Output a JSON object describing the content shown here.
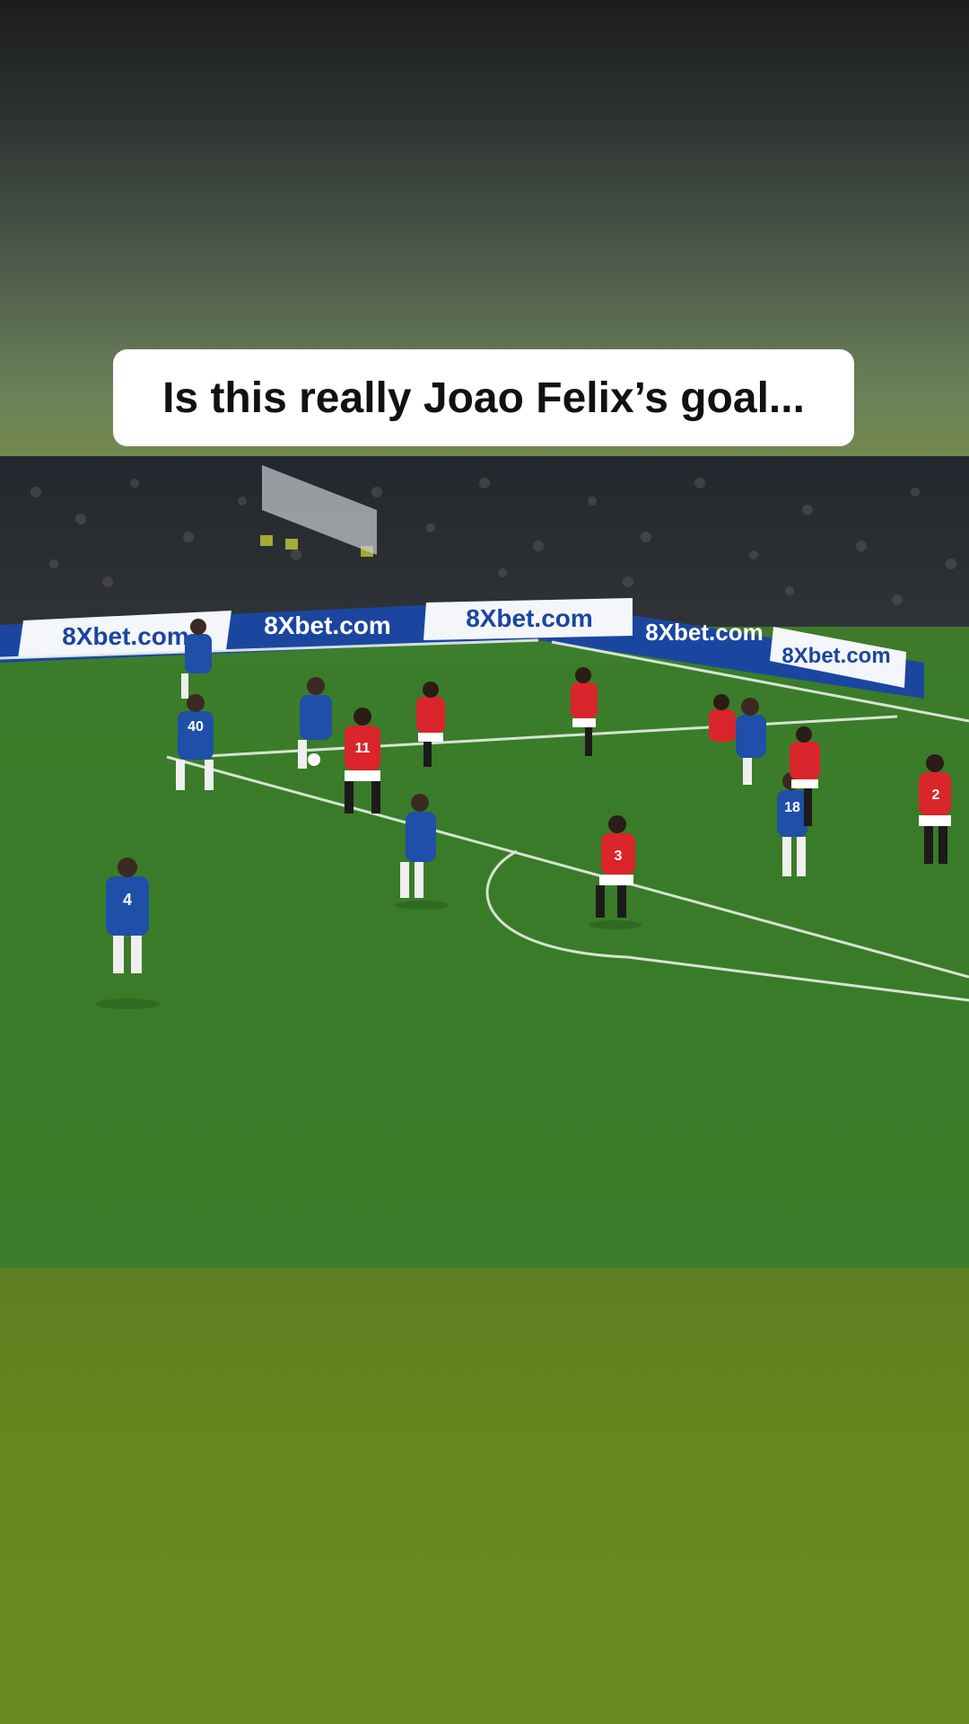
{
  "caption": {
    "text": "Is this really Joao Felix’s goal..."
  },
  "video": {
    "sponsor_boards": [
      "8Xbet.com",
      "8Xbet.com",
      "8Xbet.com",
      "8Xbet.com",
      "8Xbet.com"
    ],
    "visible_numbers": [
      "4",
      "40",
      "11",
      "3",
      "18",
      "2"
    ]
  },
  "colors": {
    "blue_kit": "#1f4fa8",
    "red_kit": "#d9252b",
    "pitch": "#3f7a2a",
    "board_blue": "#1b46a0"
  }
}
